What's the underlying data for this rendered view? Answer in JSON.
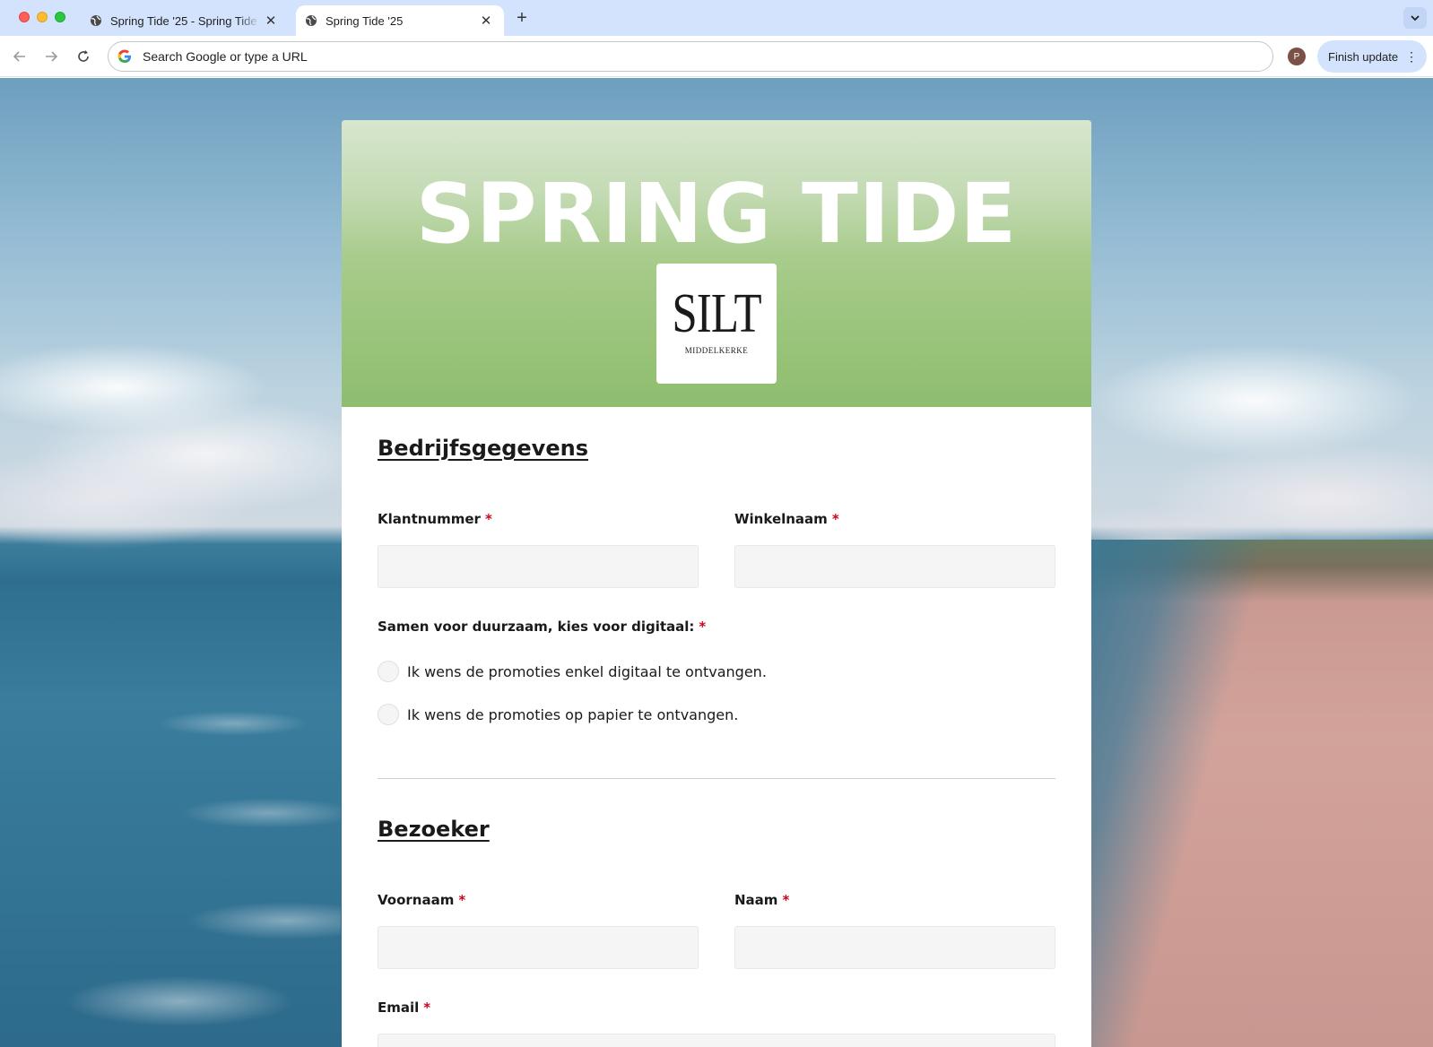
{
  "browser": {
    "tabs": [
      {
        "title": "Spring Tide '25 - Spring Tide",
        "active": false
      },
      {
        "title": "Spring Tide '25",
        "active": true
      }
    ],
    "address_bar": {
      "placeholder": "Search Google or type a URL",
      "value": ""
    },
    "profile_initial": "P",
    "finish_update_label": "Finish update"
  },
  "banner": {
    "title": "SPRING TIDE",
    "logo_text": "SILT",
    "logo_subtext": "MIDDELKERKE"
  },
  "form": {
    "section_company": {
      "title": "Bedrijfsgegevens",
      "customer_number_label": "Klantnummer",
      "shop_name_label": "Winkelnaam",
      "digital_question": "Samen voor duurzaam, kies voor digitaal:",
      "options": [
        {
          "label": "Ik wens de promoties enkel digitaal te ontvangen.",
          "selected": false
        },
        {
          "label": "Ik wens de promoties op papier te ontvangen.",
          "selected": false
        }
      ]
    },
    "section_visitor": {
      "title": "Bezoeker",
      "first_name_label": "Voornaam",
      "last_name_label": "Naam",
      "email_label": "Email"
    },
    "required_marker": "*"
  },
  "colors": {
    "accent_required": "#d0021b",
    "tabbar": "#d3e3fd",
    "banner_green": "#9bc57c"
  }
}
